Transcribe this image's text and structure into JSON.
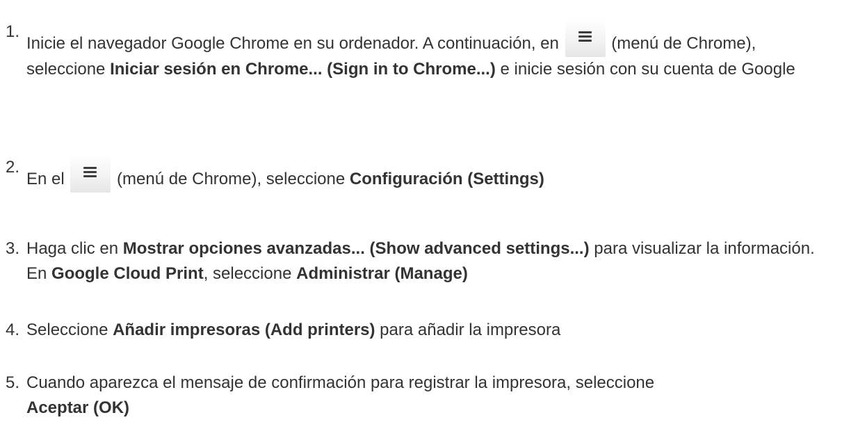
{
  "steps": [
    {
      "number": "1.",
      "text_1": "Inicie el navegador Google Chrome en su ordenador. A continuación, en",
      "menu_icon": "hamburger-menu-icon",
      "text_2": "(menú de Chrome), seleccione",
      "bold_1": "Iniciar sesión en Chrome... (Sign in to Chrome...)",
      "text_3": "e inicie sesión con su cuenta de Google"
    },
    {
      "number": "2.",
      "text_1": "En el",
      "menu_icon": "hamburger-menu-icon",
      "text_2": "(menú de Chrome), seleccione",
      "bold_1": "Configuración (Settings)"
    },
    {
      "number": "3.",
      "text_1": "Haga clic en",
      "bold_1": "Mostrar opciones avanzadas... (Show advanced settings...)",
      "text_2": "para visualizar la información. En",
      "bold_2": "Google Cloud Print",
      "text_3": ", seleccione",
      "bold_3": "Administrar (Manage)"
    },
    {
      "number": "4.",
      "text_1": "Seleccione",
      "bold_1": "Añadir impresoras (Add printers)",
      "text_2": "para añadir la impresora"
    },
    {
      "number": "5.",
      "text_1": "Cuando aparezca el mensaje de confirmación para registrar la impresora, seleccione",
      "bold_1": "Aceptar (OK)"
    }
  ]
}
